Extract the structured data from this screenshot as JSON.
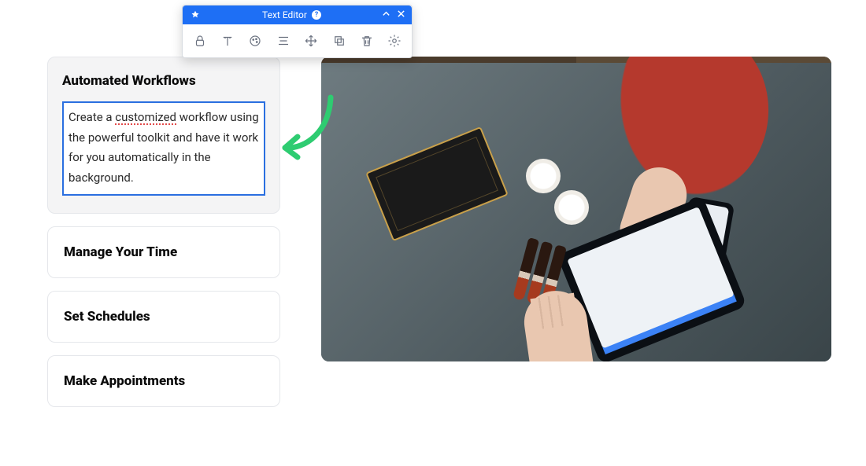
{
  "toolbox": {
    "title": "Text Editor",
    "tools": {
      "lock": {
        "name": "lock-icon"
      },
      "text": {
        "name": "text-style-icon"
      },
      "color": {
        "name": "palette-icon"
      },
      "align": {
        "name": "align-icon"
      },
      "move": {
        "name": "move-icon"
      },
      "layer": {
        "name": "layer-icon"
      },
      "delete": {
        "name": "trash-icon"
      },
      "settings": {
        "name": "settings-icon"
      }
    }
  },
  "panels": [
    {
      "title": "Automated Workflows",
      "body_pre": "Create a ",
      "body_err": "customized",
      "body_post": " workflow using the powerful toolkit and have it work for you automatically in the background.",
      "active": true
    },
    {
      "title": "Manage Your Time"
    },
    {
      "title": "Set Schedules"
    },
    {
      "title": "Make Appointments"
    }
  ],
  "arrow_color": "#2ecc71"
}
